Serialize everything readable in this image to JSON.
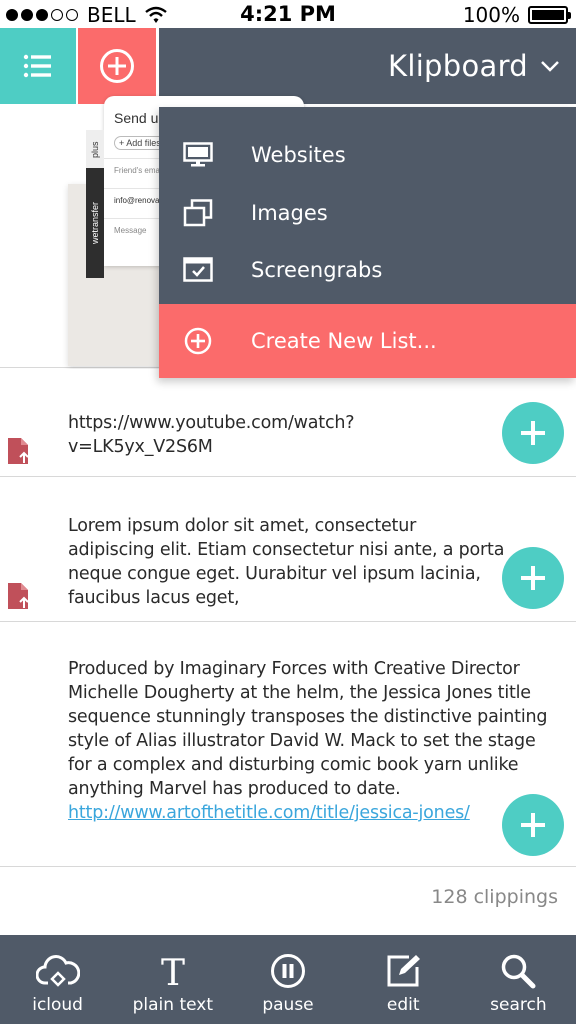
{
  "status": {
    "carrier": "BELL",
    "time": "4:21 PM",
    "battery": "100%",
    "signal_bars": 3,
    "signal_total": 5,
    "battery_level": 1.0
  },
  "header": {
    "menu_icon": "list-icon",
    "add_icon": "plus-circle-icon",
    "title": "Klipboard",
    "title_icon": "chevron-down-icon",
    "colors": {
      "teal": "#4ecdc4",
      "coral": "#fb6b6b",
      "slate": "#505a68"
    }
  },
  "dropdown": {
    "items": [
      {
        "label": "Websites",
        "icon": "monitor-icon"
      },
      {
        "label": "Images",
        "icon": "images-icon"
      },
      {
        "label": "Screengrabs",
        "icon": "screengrab-icon"
      }
    ],
    "create_label": "Create New List...",
    "create_icon": "plus-circle-icon"
  },
  "thumbnail": {
    "title": "Send up",
    "chip": "+ Add files",
    "field_friend": "Friend's email",
    "field_email": "info@renova",
    "field_message": "Message",
    "tab_plus": "plus",
    "tab_brand": "wetransfer"
  },
  "clippings": [
    {
      "text": "https://www.youtube.com/watch?v=LK5yx_V2S6M",
      "link": ""
    },
    {
      "text": "Lorem ipsum dolor sit amet, consectetur adipiscing elit. Etiam consectetur nisi ante, a porta neque congue eget. Uurabitur vel ipsum lacinia, faucibus lacus eget,",
      "link": ""
    },
    {
      "text": "Produced by Imaginary Forces with Creative Director Michelle Dougherty at the helm, the Jessica Jones title sequence stunningly transposes the distinctive painting style of Alias illustrator David W. Mack to set the stage for a complex and disturbing comic book yarn unlike anything Marvel has produced to date.",
      "link": "http://www.artofthetitle.com/title/jessica-jones/"
    }
  ],
  "count_label": "128 clippings",
  "toolbar": [
    {
      "label": "icloud",
      "icon": "cloud-sync-icon"
    },
    {
      "label": "plain text",
      "icon": "text-icon"
    },
    {
      "label": "pause",
      "icon": "pause-icon"
    },
    {
      "label": "edit",
      "icon": "edit-icon"
    },
    {
      "label": "search",
      "icon": "search-icon"
    }
  ]
}
